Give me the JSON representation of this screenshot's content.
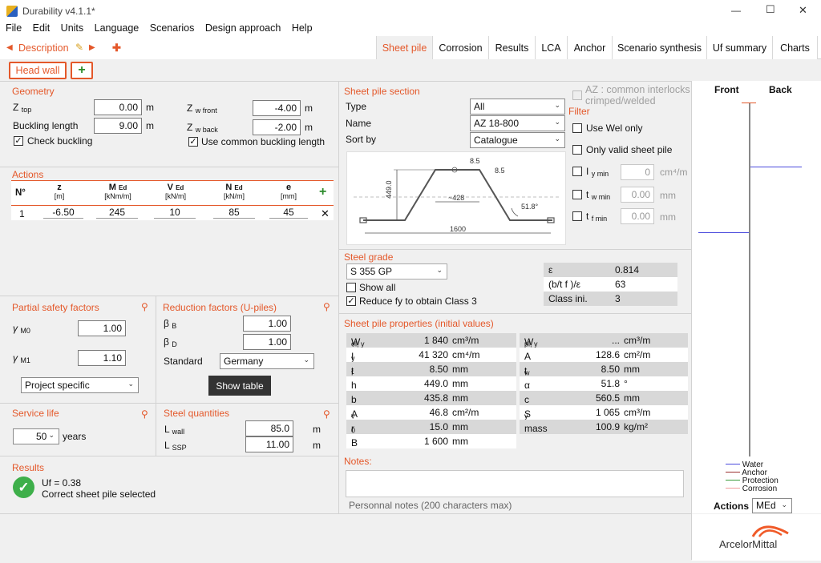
{
  "window": {
    "title": "Durability v4.1.1*",
    "min": "—",
    "max": "☐",
    "close": "✕"
  },
  "menu": [
    "File",
    "Edit",
    "Units",
    "Language",
    "Scenarios",
    "Design approach",
    "Help"
  ],
  "description": {
    "label": "Description",
    "prev": "◀",
    "next": "▶",
    "add": "✚"
  },
  "tabs": [
    "Sheet pile",
    "Corrosion",
    "Results",
    "LCA",
    "Anchor",
    "Scenario synthesis",
    "Uf summary",
    "Charts"
  ],
  "head_wall": {
    "label": "Head wall",
    "add": "+"
  },
  "geometry": {
    "title": "Geometry",
    "z_top_label": "Z",
    "z_top_sub": "top",
    "z_top": "0.00",
    "z_top_unit": "m",
    "buckling_label": "Buckling length",
    "buckling": "9.00",
    "buckling_unit": "m",
    "check_buckling": "Check buckling",
    "zw_front_label": "Z",
    "zw_front_sub": "w front",
    "zw_front": "-4.00",
    "zw_front_unit": "m",
    "zw_back_label": "Z",
    "zw_back_sub": "w back",
    "zw_back": "-2.00",
    "zw_back_unit": "m",
    "use_common": "Use common buckling length"
  },
  "actions": {
    "title": "Actions",
    "headers": [
      {
        "top": "N°",
        "sub": "",
        "unit": ""
      },
      {
        "top": "z",
        "sub": "",
        "unit": "[m]"
      },
      {
        "top": "M",
        "sub": "Ed",
        "unit": "[kNm/m]"
      },
      {
        "top": "V",
        "sub": "Ed",
        "unit": "[kN/m]"
      },
      {
        "top": "N",
        "sub": "Ed",
        "unit": "[kN/m]"
      },
      {
        "top": "e",
        "sub": "",
        "unit": "[mm]"
      }
    ],
    "rows": [
      {
        "n": "1",
        "z": "-6.50",
        "m": "245",
        "v": "10",
        "nv": "85",
        "e": "45"
      }
    ],
    "add": "+",
    "delete": "✕"
  },
  "partial_safety": {
    "title": "Partial safety factors",
    "g0_label": "γ",
    "g0_sub": "M0",
    "g0": "1.00",
    "g1_label": "γ",
    "g1_sub": "M1",
    "g1": "1.10",
    "mode": "Project specific"
  },
  "reduction": {
    "title": "Reduction factors (U-piles)",
    "bb_label": "β",
    "bb_sub": "B",
    "bb": "1.00",
    "bd_label": "β",
    "bd_sub": "D",
    "bd": "1.00",
    "standard_label": "Standard",
    "standard": "Germany",
    "show_table": "Show table"
  },
  "service_life": {
    "title": "Service life",
    "value": "50",
    "unit": "years"
  },
  "steel_quantities": {
    "title": "Steel quantities",
    "lwall_label": "L",
    "lwall_sub": "wall",
    "lwall": "85.0",
    "lwall_unit": "m",
    "lssp_label": "L",
    "lssp_sub": "SSP",
    "lssp": "11.00",
    "lssp_unit": "m"
  },
  "results": {
    "title": "Results",
    "uf": "Uf = 0.38",
    "msg": "Correct sheet pile selected"
  },
  "section": {
    "title": "Sheet pile section",
    "type_label": "Type",
    "type": "All",
    "name_label": "Name",
    "name": "AZ 18-800",
    "sort_label": "Sort by",
    "sort": "Catalogue",
    "az_common": "AZ : common interlocks",
    "az_common2": "crimped/welded",
    "dims": {
      "t1": "8.5",
      "t2": "8.5",
      "h": "449.0",
      "w": "~428",
      "ang": "51.8°",
      "b": "1600"
    }
  },
  "filter": {
    "title": "Filter",
    "use_wel": "Use Wel only",
    "only_valid": "Only valid sheet pile",
    "iymin_label": "I",
    "iymin_sub": "y min",
    "iymin": "0",
    "iymin_unit": "cm⁴/m",
    "twmin_label": "t",
    "twmin_sub": "w min",
    "twmin": "0.00",
    "twmin_unit": "mm",
    "tfmin_label": "t",
    "tfmin_sub": "f min",
    "tfmin": "0.00",
    "tfmin_unit": "mm"
  },
  "steel_grade": {
    "title": "Steel grade",
    "grade": "S 355 GP",
    "show_all": "Show all",
    "reduce_fy": "Reduce fy to obtain Class 3",
    "props": [
      {
        "k": "ε",
        "v": "0.814"
      },
      {
        "k": "(b/t f )/ε",
        "v": "63"
      },
      {
        "k": "Class ini.",
        "v": "3"
      }
    ]
  },
  "properties": {
    "title": "Sheet pile properties (initial values)",
    "left": [
      {
        "k": "W",
        "sub": "el, y",
        "v": "1 840",
        "u": "cm³/m"
      },
      {
        "k": "I",
        "sub": "y",
        "v": "41 320",
        "u": "cm⁴/m"
      },
      {
        "k": "t",
        "sub": "f",
        "v": "8.50",
        "u": "mm"
      },
      {
        "k": "h",
        "sub": "",
        "v": "449.0",
        "u": "mm"
      },
      {
        "k": "b",
        "sub": "",
        "v": "435.8",
        "u": "mm"
      },
      {
        "k": "A",
        "sub": "v",
        "v": "46.8",
        "u": "cm²/m"
      },
      {
        "k": "r",
        "sub": "0",
        "v": "15.0",
        "u": "mm"
      },
      {
        "k": "B",
        "sub": "",
        "v": "1 600",
        "u": "mm"
      }
    ],
    "right": [
      {
        "k": "W",
        "sub": "pl, y",
        "v": "...",
        "u": "cm³/m"
      },
      {
        "k": "A",
        "sub": "",
        "v": "128.6",
        "u": "cm²/m"
      },
      {
        "k": "t",
        "sub": "w",
        "v": "8.50",
        "u": "mm"
      },
      {
        "k": "α",
        "sub": "",
        "v": "51.8",
        "u": "°"
      },
      {
        "k": "c",
        "sub": "",
        "v": "560.5",
        "u": "mm"
      },
      {
        "k": "S",
        "sub": "y",
        "v": "1 065",
        "u": "cm³/m"
      },
      {
        "k": "mass",
        "sub": "",
        "v": "100.9",
        "u": "kg/m²"
      }
    ]
  },
  "notes": {
    "title": "Notes:",
    "hint": "Personnal notes (200 characters max)"
  },
  "chart": {
    "front": "Front",
    "back": "Back",
    "legend": [
      "Water",
      "Anchor",
      "Protection",
      "Corrosion"
    ],
    "legend_colors": [
      "#4a4adc",
      "#9b3030",
      "#3c9b3c",
      "#f09a9a"
    ],
    "actions_label": "Actions",
    "actions_value": "MEd"
  },
  "logo": "ArcelorMittal"
}
